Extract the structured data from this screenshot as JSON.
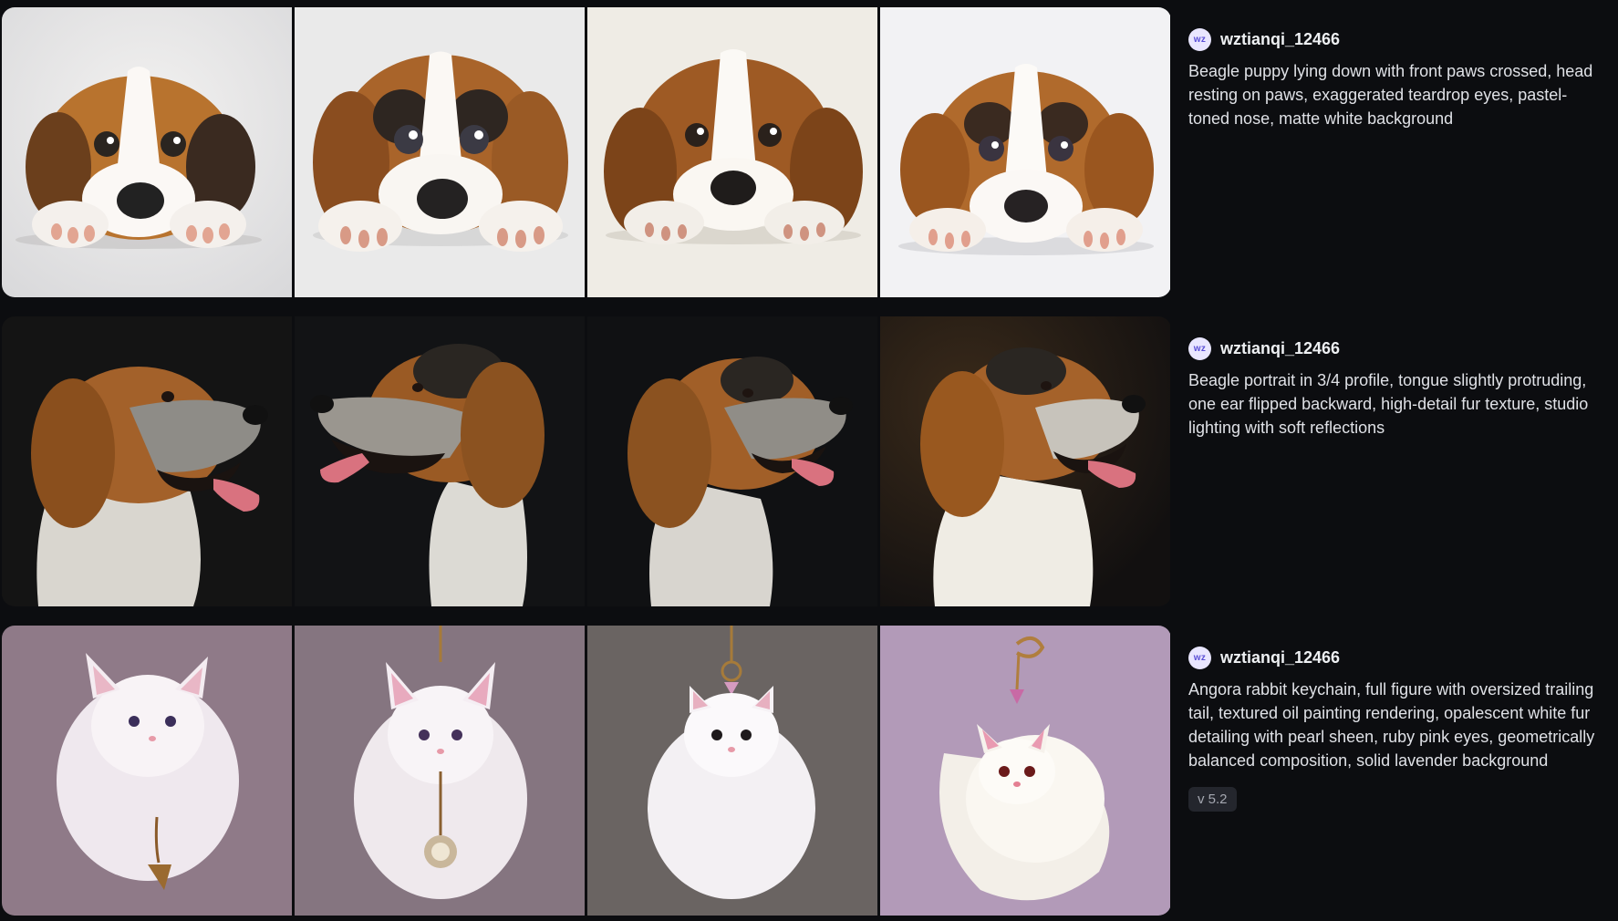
{
  "posts": [
    {
      "avatar": "wz",
      "username": "wztianqi_12466",
      "prompt": "Beagle puppy lying down with front paws crossed, head resting on paws, exaggerated teardrop eyes, pastel-toned nose, matte white background",
      "images": [
        {
          "alt": "Beagle puppy lying down, variation 1"
        },
        {
          "alt": "Beagle puppy lying down, variation 2"
        },
        {
          "alt": "Beagle puppy lying down, variation 3"
        },
        {
          "alt": "Beagle puppy lying down, variation 4"
        }
      ]
    },
    {
      "avatar": "wz",
      "username": "wztianqi_12466",
      "prompt": "Beagle portrait in 3/4 profile, tongue slightly protruding, one ear flipped backward, high-detail fur texture, studio lighting with soft reflections",
      "images": [
        {
          "alt": "Beagle profile portrait, variation 1"
        },
        {
          "alt": "Beagle profile portrait, variation 2"
        },
        {
          "alt": "Beagle profile portrait, variation 3"
        },
        {
          "alt": "Beagle profile portrait, variation 4"
        }
      ]
    },
    {
      "avatar": "wz",
      "username": "wztianqi_12466",
      "prompt": "Angora rabbit keychain, full figure with oversized trailing tail, textured oil painting rendering, opalescent white fur detailing with pearl sheen, ruby pink eyes, geometrically balanced composition, solid lavender background",
      "version": "v 5.2",
      "images": [
        {
          "alt": "Angora rabbit keychain, variation 1"
        },
        {
          "alt": "Angora rabbit keychain, variation 2"
        },
        {
          "alt": "Angora rabbit keychain, variation 3"
        },
        {
          "alt": "Angora rabbit keychain, variation 4"
        }
      ]
    }
  ],
  "colors": {
    "page_background": "#0c0d10",
    "text": "#dfe1e6",
    "avatar_background": "#e9e6ff",
    "avatar_text": "#5b4fd6",
    "version_badge_background": "#24262d"
  }
}
